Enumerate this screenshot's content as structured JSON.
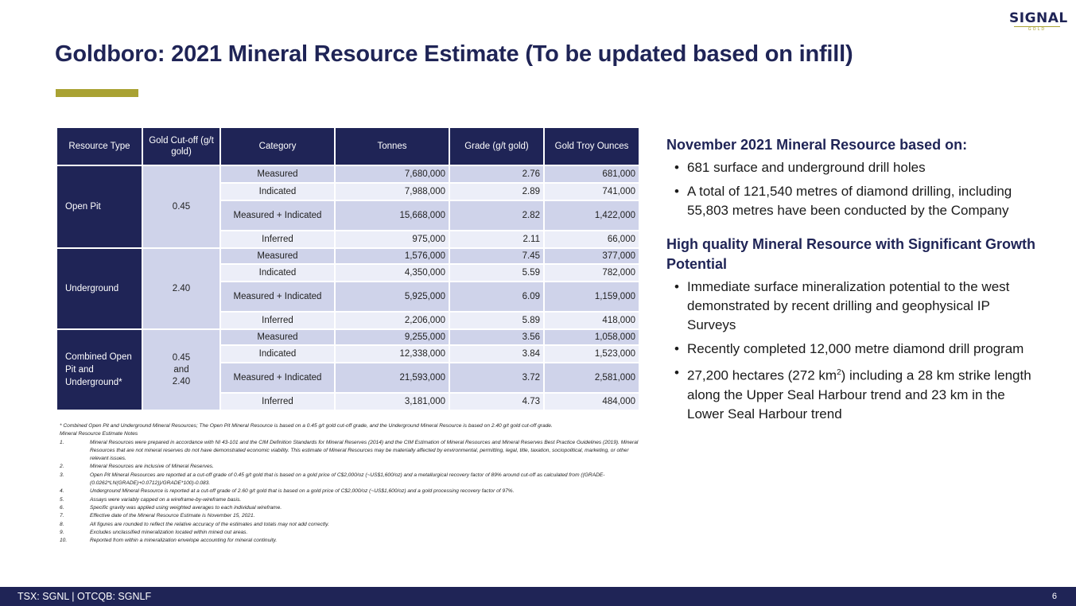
{
  "logo": {
    "word": "SIGNAL",
    "sub": "GOLD"
  },
  "title": "Goldboro: 2021 Mineral Resource Estimate (To be updated based on infill)",
  "table": {
    "headers": [
      "Resource Type",
      "Gold Cut-off (g/t gold)",
      "Category",
      "Tonnes",
      "Grade (g/t gold)",
      "Gold Troy Ounces"
    ],
    "groups": [
      {
        "type": "Open Pit",
        "cutoff": "0.45",
        "rows": [
          {
            "category": "Measured",
            "tonnes": "7,680,000",
            "grade": "2.76",
            "ounces": "681,000"
          },
          {
            "category": "Indicated",
            "tonnes": "7,988,000",
            "grade": "2.89",
            "ounces": "741,000"
          },
          {
            "category": "Measured + Indicated",
            "tonnes": "15,668,000",
            "grade": "2.82",
            "ounces": "1,422,000"
          },
          {
            "category": "Inferred",
            "tonnes": "975,000",
            "grade": "2.11",
            "ounces": "66,000"
          }
        ]
      },
      {
        "type": "Underground",
        "cutoff": "2.40",
        "rows": [
          {
            "category": "Measured",
            "tonnes": "1,576,000",
            "grade": "7.45",
            "ounces": "377,000"
          },
          {
            "category": "Indicated",
            "tonnes": "4,350,000",
            "grade": "5.59",
            "ounces": "782,000"
          },
          {
            "category": "Measured + Indicated",
            "tonnes": "5,925,000",
            "grade": "6.09",
            "ounces": "1,159,000"
          },
          {
            "category": "Inferred",
            "tonnes": "2,206,000",
            "grade": "5.89",
            "ounces": "418,000"
          }
        ]
      },
      {
        "type": "Combined Open Pit and Underground*",
        "cutoff": "0.45 and 2.40",
        "rows": [
          {
            "category": "Measured",
            "tonnes": "9,255,000",
            "grade": "3.56",
            "ounces": "1,058,000"
          },
          {
            "category": "Indicated",
            "tonnes": "12,338,000",
            "grade": "3.84",
            "ounces": "1,523,000"
          },
          {
            "category": "Measured + Indicated",
            "tonnes": "21,593,000",
            "grade": "3.72",
            "ounces": "2,581,000"
          },
          {
            "category": "Inferred",
            "tonnes": "3,181,000",
            "grade": "4.73",
            "ounces": "484,000"
          }
        ]
      }
    ]
  },
  "notes": {
    "footnote": "* Combined Open Pit and Underground Mineral Resources; The Open Pit Mineral Resource is based on a 0.45 g/t gold cut-off grade, and the Underground Mineral Resource is based on 2.40 g/t gold cut-off grade.",
    "heading": "Mineral Resource Estimate Notes",
    "items": [
      {
        "num": "1.",
        "text": "Mineral Resources were prepared in accordance with NI 43-101 and the CIM Definition Standards for Mineral Reserves (2014) and the CIM Estimation of Mineral Resources and Mineral Reserves Best Practice Guidelines (2019). Mineral Resources that are not mineral reserves do not have demonstrated economic viability. This estimate of Mineral Resources may be materially affected by environmental, permitting, legal, title, taxation, sociopolitical, marketing, or other relevant issues."
      },
      {
        "num": "2.",
        "text": "Mineral Resources are inclusive of Mineral Reserves."
      },
      {
        "num": "3.",
        "text": "Open Pit Mineral Resources are reported at a cut-off grade of 0.45 g/t gold that is based on a gold price of C$2,000/oz (~US$1,600/oz) and a metallurgical recovery factor of 89% around cut-off as calculated from ((GRADE-(0.0262*LN(GRADE)+0.0712))/GRADE*100)-0.083."
      },
      {
        "num": "4.",
        "text": "Underground Mineral Resource is reported at a cut-off grade of 2.60 g/t gold that is based on a gold price of C$2,000/oz (~US$1,600/oz) and a gold processing recovery factor of 97%."
      },
      {
        "num": "5.",
        "text": "Assays were variably capped on a wireframe-by-wireframe basis."
      },
      {
        "num": "6.",
        "text": "Specific gravity was applied using weighted averages to each individual wireframe."
      },
      {
        "num": "7.",
        "text": "Effective date of the Mineral Resource Estimate is November 15, 2021."
      },
      {
        "num": "8.",
        "text": "All figures are rounded to reflect the relative accuracy of the estimates and totals may not add correctly."
      },
      {
        "num": "9.",
        "text": "Excludes unclassified mineralization located within mined out areas."
      },
      {
        "num": "10.",
        "text": "Reported from within a mineralization envelope accounting for mineral continuity."
      }
    ]
  },
  "right": {
    "heading1": "November 2021 Mineral Resource based on:",
    "bullets1": [
      "681 surface and underground drill holes",
      "A total of 121,540 metres of diamond drilling, including 55,803 metres have been conducted by the Company"
    ],
    "heading2": "High quality Mineral Resource with Significant Growth Potential",
    "bullets2": [
      "Immediate surface mineralization potential to the west demonstrated by recent drilling and geophysical IP Surveys",
      "Recently completed 12,000 metre diamond drill program"
    ],
    "bullet_last": {
      "before": "27,200 hectares (272 km",
      "sup": "2",
      "after": ") including a 28 km strike length along the Upper Seal Harbour trend and 23 km in the Lower Seal Harbour trend"
    }
  },
  "footer": {
    "ticker": "TSX: SGNL | OTCQB: SGNLF",
    "page": "6"
  }
}
